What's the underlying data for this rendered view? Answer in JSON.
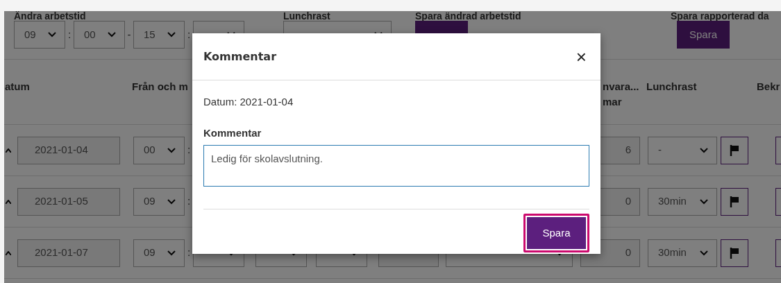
{
  "toolbar": [
    {
      "kind": "time-range",
      "label": "Ändra arbetstid",
      "values": [
        "09",
        "00",
        "15"
      ],
      "separators": [
        ":",
        "-",
        ":"
      ]
    },
    {
      "kind": "select",
      "label": "Lunchrast"
    },
    {
      "kind": "button",
      "label": "Spara ändrad arbetstid"
    },
    {
      "kind": "button",
      "label": "Spara rapporterad da",
      "button": "Spara"
    }
  ],
  "table": {
    "columns": [
      {
        "kind": "date",
        "label": "atum"
      },
      {
        "kind": "from",
        "label": "Från och m"
      },
      {
        "kind": "absence",
        "label": "nvara...\nmar"
      },
      {
        "kind": "lunch",
        "label": "Lunchrast"
      },
      {
        "kind": "confirm",
        "label": "Bekr"
      }
    ],
    "rows": [
      {
        "date": "2021-01-04",
        "from_hour": "00",
        "sep_1": ":",
        "absence": "6",
        "lunch": "-"
      },
      {
        "date": "2021-01-05",
        "from_hour": "09",
        "sep_1": ":",
        "absence": "0",
        "lunch": "30min"
      },
      {
        "date": "2021-01-07",
        "from_hour": "09",
        "sep_1": ":",
        "absence": "0",
        "lunch": "30min"
      }
    ]
  },
  "modal": {
    "title": "Kommentar",
    "close": "×",
    "date_line": "Datum: 2021-01-04",
    "field_label": "Kommentar",
    "comment": "Ledig för skolavslutning.",
    "save": "Spara",
    "save_highlighted": true
  }
}
